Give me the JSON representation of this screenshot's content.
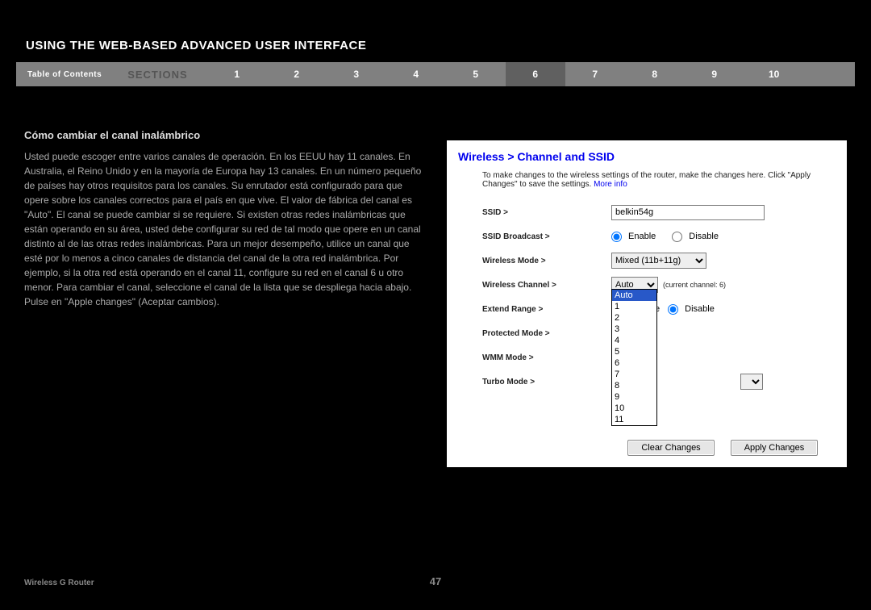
{
  "header": {
    "title": "USING THE WEB-BASED ADVANCED USER INTERFACE"
  },
  "nav": {
    "toc": "Table of Contents",
    "sections_label": "SECTIONS",
    "items": [
      "1",
      "2",
      "3",
      "4",
      "5",
      "6",
      "7",
      "8",
      "9",
      "10"
    ],
    "active_index": 5
  },
  "left": {
    "subhead": "Cómo cambiar el canal inalámbrico",
    "body": "Usted puede escoger entre varios canales de operación. En los EEUU hay 11 canales. En Australia, el Reino Unido y en la mayoría de Europa hay 13 canales. En un número pequeño de países hay otros requisitos para los canales. Su enrutador está configurado para que opere sobre los canales correctos para el país en que vive. El valor de fábrica del canal es \"Auto\". El canal se puede cambiar si se requiere. Si existen otras redes inalámbricas que están operando en su área, usted debe configurar su red de tal modo que opere en un canal distinto al de las otras redes inalámbricas. Para un mejor desempeño, utilice un canal que esté por lo menos a cinco canales de distancia del canal de la otra red inalámbrica. Por ejemplo, si la otra red está operando en el canal 11, configure su red en el canal 6 u otro menor. Para cambiar el canal, seleccione el canal de la lista que se despliega hacia abajo. Pulse en \"Apple changes\" (Aceptar cambios)."
  },
  "panel": {
    "title": "Wireless > Channel and SSID",
    "desc_a": "To make changes to the wireless settings of the router, make the changes here. Click \"Apply Changes\" to save the settings. ",
    "desc_more": "More info",
    "labels": {
      "ssid": "SSID >",
      "ssid_broadcast": "SSID Broadcast >",
      "wireless_mode": "Wireless Mode >",
      "wireless_channel": "Wireless Channel >",
      "extend_range": "Extend Range >",
      "protected_mode": "Protected Mode >",
      "wmm_mode": "WMM Mode >",
      "turbo_mode": "Turbo Mode >"
    },
    "ssid_value": "belkin54g",
    "enable": "Enable",
    "disable": "Disable",
    "mode_value": "Mixed (11b+11g)",
    "channel_value": "Auto",
    "channel_note": "(current channel: 6)",
    "channel_options": [
      "Auto",
      "1",
      "2",
      "3",
      "4",
      "5",
      "6",
      "7",
      "8",
      "9",
      "10",
      "11"
    ],
    "btn_clear": "Clear Changes",
    "btn_apply": "Apply Changes"
  },
  "footer": {
    "left": "Wireless G Router",
    "page": "47"
  }
}
